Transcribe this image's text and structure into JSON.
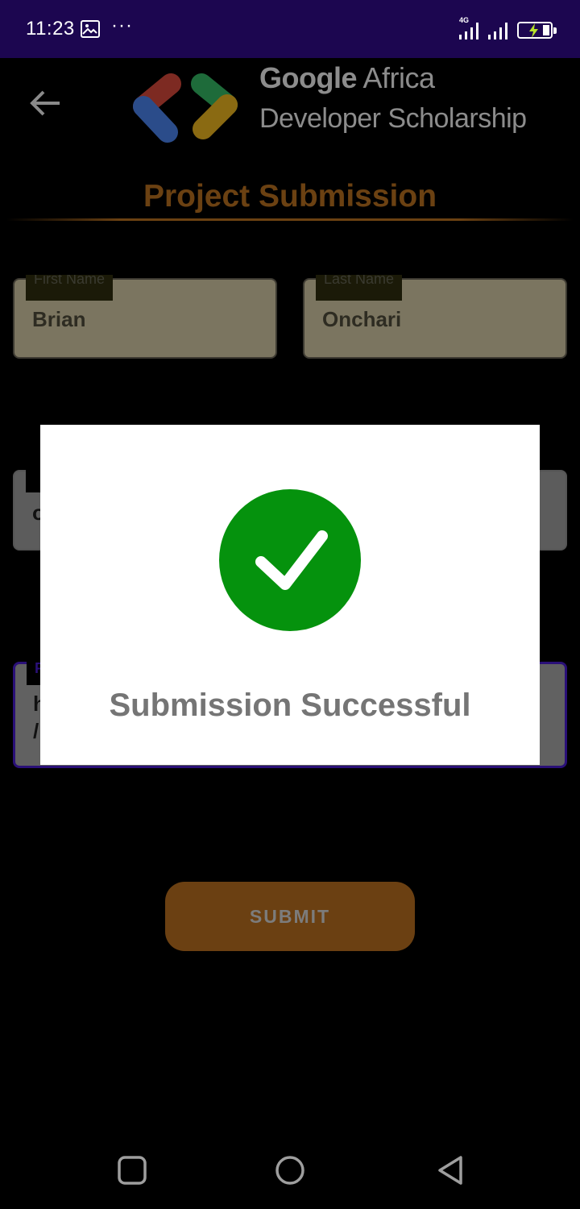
{
  "status_bar": {
    "time": "11:23",
    "more": "···",
    "network": "4G",
    "icons": [
      "gallery-icon",
      "cellular-signal-icon",
      "wifi-signal-icon",
      "battery-charging-icon"
    ]
  },
  "header": {
    "back_icon": "back-arrow-icon",
    "logo_icon": "developer-scholarship-logo",
    "brand_line1_bold": "Google",
    "brand_line1_rest": " Africa",
    "brand_line2": "Developer Scholarship"
  },
  "page": {
    "title": "Project Submission"
  },
  "form": {
    "first_name": {
      "label": "First Name",
      "value": "Brian"
    },
    "last_name": {
      "label": "Last Name",
      "value": "Onchari"
    },
    "email": {
      "value": "o"
    },
    "github": {
      "label": "P",
      "value_line1": "h",
      "value_line2": "/"
    }
  },
  "submit": {
    "label": "SUBMIT"
  },
  "dialog": {
    "icon": "checkmark-success-icon",
    "message": "Submission Successful"
  },
  "nav_bar": {
    "items": [
      "recent-apps-icon",
      "home-icon",
      "back-icon"
    ]
  },
  "colors": {
    "status_bar": "#1c0650",
    "accent_brown": "#6b4112",
    "success_green": "#05920d",
    "dialog_bg": "#ffffff"
  }
}
